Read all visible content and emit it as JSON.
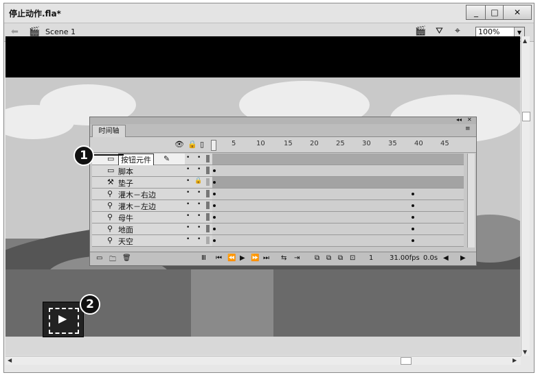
{
  "window": {
    "title": "停止动作.fla*",
    "minimize": "_",
    "maximize": "□",
    "close": "✕"
  },
  "nav": {
    "scene": "Scene 1",
    "zoom": "100%"
  },
  "timeline": {
    "tab": "时间轴",
    "ruler": [
      "5",
      "10",
      "15",
      "20",
      "25",
      "30",
      "35",
      "40",
      "45"
    ],
    "layers": [
      {
        "name": "按钮元件",
        "icon": "layer-icon",
        "lock": "•"
      },
      {
        "name": "脚本",
        "icon": "layer-icon",
        "lock": "•"
      },
      {
        "name": "垫子",
        "icon": "hammer-icon",
        "lock": "🔒"
      },
      {
        "name": "灌木－右边",
        "icon": "guide-icon",
        "lock": "•"
      },
      {
        "name": "灌木－左边",
        "icon": "guide-icon",
        "lock": "•"
      },
      {
        "name": "母牛",
        "icon": "guide-icon",
        "lock": "•"
      },
      {
        "name": "地面",
        "icon": "guide-icon",
        "lock": "•"
      },
      {
        "name": "天空",
        "icon": "guide-icon",
        "lock": "•"
      }
    ],
    "fps": "31.00fps",
    "time": "0.0s",
    "frame": "1"
  },
  "callouts": {
    "one": "1",
    "two": "2"
  }
}
